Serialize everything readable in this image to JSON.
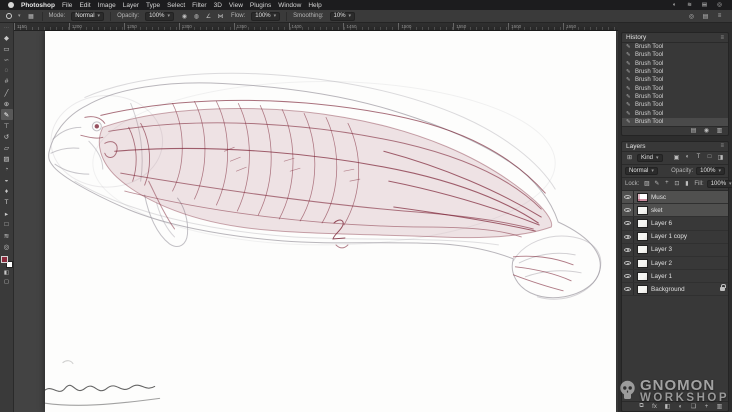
{
  "menubar": {
    "app_name": "Photoshop",
    "items": [
      "File",
      "Edit",
      "Image",
      "Layer",
      "Type",
      "Select",
      "Filter",
      "3D",
      "View",
      "Plugins",
      "Window",
      "Help"
    ],
    "status_icons": [
      {
        "name": "control-center-icon",
        "glyph": "◐"
      },
      {
        "name": "wifi-icon",
        "glyph": "≋"
      },
      {
        "name": "battery-icon",
        "glyph": "▤"
      },
      {
        "name": "spotlight-icon",
        "glyph": "◎"
      }
    ]
  },
  "options": {
    "mode_label": "Mode:",
    "mode_value": "Normal",
    "opacity_label": "Opacity:",
    "opacity_value": "100%",
    "flow_label": "Flow:",
    "flow_value": "100%",
    "smoothing_label": "Smoothing:",
    "smoothing_value": "10%",
    "left_icons": [
      {
        "name": "pressure-opacity-icon",
        "glyph": "◉"
      },
      {
        "name": "airbrush-icon",
        "glyph": "◍"
      },
      {
        "name": "brush-angle-icon",
        "glyph": "∠"
      },
      {
        "name": "symmetry-icon",
        "glyph": "⋈"
      }
    ],
    "right_icons": [
      {
        "name": "search-icon",
        "glyph": "◎"
      },
      {
        "name": "arrange-documents-icon",
        "glyph": "▤"
      },
      {
        "name": "workspace-switcher-icon",
        "glyph": "≡"
      }
    ]
  },
  "tools": {
    "foreground_color": "#8a2a3c",
    "background_color": "#ffffff",
    "items": [
      {
        "name": "move",
        "glyph": "◆",
        "selected": false
      },
      {
        "name": "marquee",
        "glyph": "▭",
        "selected": false
      },
      {
        "name": "lasso",
        "glyph": "∽",
        "selected": false
      },
      {
        "name": "quick-selection",
        "glyph": "◌",
        "selected": false
      },
      {
        "name": "crop",
        "glyph": "#",
        "selected": false
      },
      {
        "name": "eyedropper",
        "glyph": "╱",
        "selected": false
      },
      {
        "name": "healing-brush",
        "glyph": "⊕",
        "selected": false
      },
      {
        "name": "brush",
        "glyph": "✎",
        "selected": true
      },
      {
        "name": "clone-stamp",
        "glyph": "⊤",
        "selected": false
      },
      {
        "name": "history-brush",
        "glyph": "↺",
        "selected": false
      },
      {
        "name": "eraser",
        "glyph": "▱",
        "selected": false
      },
      {
        "name": "gradient",
        "glyph": "▨",
        "selected": false
      },
      {
        "name": "blur",
        "glyph": "◔",
        "selected": false
      },
      {
        "name": "dodge",
        "glyph": "◒",
        "selected": false
      },
      {
        "name": "pen",
        "glyph": "♦",
        "selected": false
      },
      {
        "name": "type",
        "glyph": "T",
        "selected": false
      },
      {
        "name": "path-selection",
        "glyph": "▸",
        "selected": false
      },
      {
        "name": "shape",
        "glyph": "□",
        "selected": false
      },
      {
        "name": "hand",
        "glyph": "≋",
        "selected": false
      },
      {
        "name": "zoom",
        "glyph": "◎",
        "selected": false
      }
    ]
  },
  "ruler": {
    "labels": [
      "1150",
      "1200",
      "1250",
      "1300",
      "1350",
      "1400",
      "1450",
      "1500",
      "1550",
      "1600",
      "1650"
    ]
  },
  "history": {
    "title": "History",
    "icon_glyph": "✎",
    "entries": [
      "Brush Tool",
      "Brush Tool",
      "Brush Tool",
      "Brush Tool",
      "Brush Tool",
      "Brush Tool",
      "Brush Tool",
      "Brush Tool",
      "Brush Tool",
      "Brush Tool"
    ],
    "footer_icons": [
      {
        "name": "new-document-from-state-icon",
        "glyph": "▤"
      },
      {
        "name": "new-snapshot-icon",
        "glyph": "◉"
      },
      {
        "name": "delete-state-icon",
        "glyph": "▥"
      }
    ]
  },
  "layers": {
    "title": "Layers",
    "filter_grid_glyph": "⊞",
    "filter_label": "Kind",
    "filter_icons": [
      {
        "name": "filter-pixel-layers-icon",
        "glyph": "▣"
      },
      {
        "name": "filter-adjustment-layers-icon",
        "glyph": "◐"
      },
      {
        "name": "filter-type-layers-icon",
        "glyph": "T"
      },
      {
        "name": "filter-shape-layers-icon",
        "glyph": "□"
      },
      {
        "name": "filter-smart-objects-icon",
        "glyph": "◨"
      }
    ],
    "blend_mode": "Normal",
    "opacity_label": "Opacity:",
    "opacity_value": "100%",
    "lock_label": "Lock:",
    "lock_icons": [
      {
        "name": "lock-transparency-icon",
        "glyph": "▨"
      },
      {
        "name": "lock-image-icon",
        "glyph": "✎"
      },
      {
        "name": "lock-position-icon",
        "glyph": "+"
      },
      {
        "name": "lock-artboard-icon",
        "glyph": "⊡"
      },
      {
        "name": "lock-all-icon",
        "glyph": "▮"
      }
    ],
    "fill_label": "Fill:",
    "fill_value": "100%",
    "items": [
      {
        "name": "Musc",
        "selected": true,
        "locked": false
      },
      {
        "name": "sket",
        "selected": true,
        "locked": false
      },
      {
        "name": "Layer 6",
        "selected": false,
        "locked": false
      },
      {
        "name": "Layer 1 copy",
        "selected": false,
        "locked": false
      },
      {
        "name": "Layer 3",
        "selected": false,
        "locked": false
      },
      {
        "name": "Layer 2",
        "selected": false,
        "locked": false
      },
      {
        "name": "Layer 1",
        "selected": false,
        "locked": false
      },
      {
        "name": "Background",
        "selected": false,
        "locked": true
      }
    ],
    "footer_icons": [
      {
        "name": "link-layers-icon",
        "glyph": "⧉"
      },
      {
        "name": "layer-effects-icon",
        "glyph": "fx"
      },
      {
        "name": "layer-mask-icon",
        "glyph": "◧"
      },
      {
        "name": "adjustment-layer-icon",
        "glyph": "◐"
      },
      {
        "name": "new-group-icon",
        "glyph": "❑"
      },
      {
        "name": "new-layer-icon",
        "glyph": "+"
      },
      {
        "name": "delete-layer-icon",
        "glyph": "▥"
      }
    ]
  },
  "watermark": {
    "title": "GNOMON",
    "subtitle": "WORKSHOP"
  },
  "colors": {
    "accent_red": "#8a2a3c",
    "canvas": "#fdfdfc",
    "pasteboard": "#434343"
  }
}
